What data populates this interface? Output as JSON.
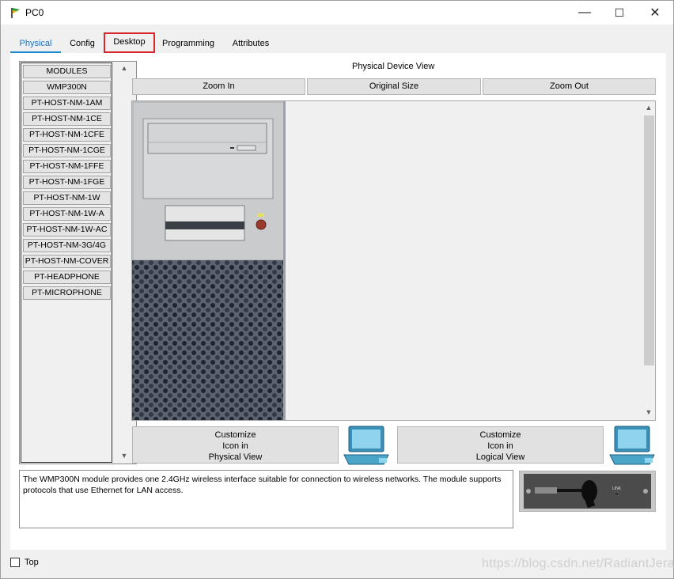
{
  "window": {
    "title": "PC0",
    "minimize": "—",
    "maximize": "☐",
    "close": "✕"
  },
  "tabs": [
    {
      "label": "Physical",
      "active": true
    },
    {
      "label": "Config"
    },
    {
      "label": "Desktop",
      "highlighted": true
    },
    {
      "label": "Programming"
    },
    {
      "label": "Attributes"
    }
  ],
  "modules": [
    "MODULES",
    "WMP300N",
    "PT-HOST-NM-1AM",
    "PT-HOST-NM-1CE",
    "PT-HOST-NM-1CFE",
    "PT-HOST-NM-1CGE",
    "PT-HOST-NM-1FFE",
    "PT-HOST-NM-1FGE",
    "PT-HOST-NM-1W",
    "PT-HOST-NM-1W-A",
    "PT-HOST-NM-1W-AC",
    "PT-HOST-NM-3G/4G",
    "PT-HOST-NM-COVER",
    "PT-HEADPHONE",
    "PT-MICROPHONE"
  ],
  "physical_view": {
    "title": "Physical Device View",
    "zoom_in": "Zoom In",
    "original_size": "Original Size",
    "zoom_out": "Zoom Out"
  },
  "customize": {
    "physical": [
      "Customize",
      "Icon in",
      "Physical View"
    ],
    "logical": [
      "Customize",
      "Icon in",
      "Logical View"
    ]
  },
  "description": "The WMP300N module provides one 2.4GHz wireless interface suitable for connection to wireless networks. The module supports protocols that use Ethernet for LAN access.",
  "module_image_label": "LINK",
  "footer": {
    "top_label": "Top",
    "top_checked": false
  },
  "watermark": "https://blog.csdn.net/RadiantJeral",
  "colors": {
    "accent": "#1a8ad1",
    "highlight": "#d9262b"
  }
}
